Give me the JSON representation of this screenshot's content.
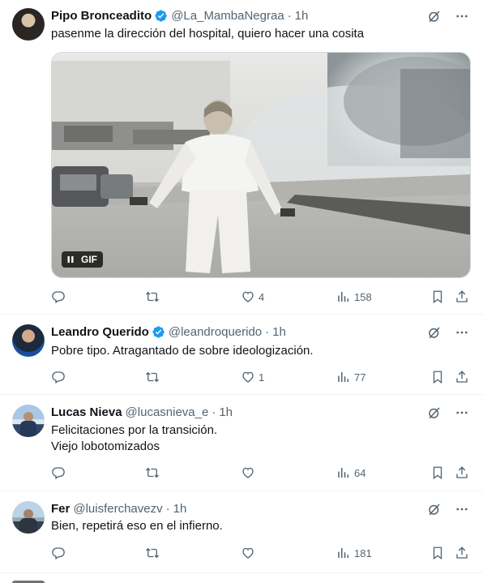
{
  "tweets": [
    {
      "name": "Pipo Bronceadito",
      "verified": true,
      "handle": "@La_MambaNegraa",
      "time": "1h",
      "text": "pasenme la dirección del hospital, quiero hacer una cosita",
      "media": {
        "type": "gif",
        "badge": "GIF"
      },
      "replies": "",
      "retweets": "",
      "likes": "4",
      "views": "158"
    },
    {
      "name": "Leandro Querido",
      "verified": true,
      "handle": "@leandroquerido",
      "time": "1h",
      "text": "Pobre tipo. Atragantado de sobre ideologización.",
      "replies": "",
      "retweets": "",
      "likes": "1",
      "views": "77"
    },
    {
      "name": "Lucas Nieva",
      "verified": false,
      "handle": "@lucasnieva_e",
      "time": "1h",
      "text_lines": [
        "Felicitaciones por la transición.",
        "Viejo lobotomizados"
      ],
      "replies": "",
      "retweets": "",
      "likes": "",
      "views": "64"
    },
    {
      "name": "Fer",
      "verified": false,
      "handle": "@luisferchavezv",
      "time": "1h",
      "text": "Bien, repetirá eso en el infierno.",
      "replies": "",
      "retweets": "",
      "likes": "",
      "views": "181"
    }
  ],
  "separator": "·",
  "colors": {
    "accent": "#1d9bf0",
    "muted": "#536471",
    "text": "#0f1419",
    "divider": "#eff3f4"
  },
  "icons": [
    "verified-badge-icon",
    "grok-icon",
    "more-icon",
    "reply-icon",
    "retweet-icon",
    "like-icon",
    "views-icon",
    "bookmark-icon",
    "share-icon",
    "pause-icon"
  ]
}
